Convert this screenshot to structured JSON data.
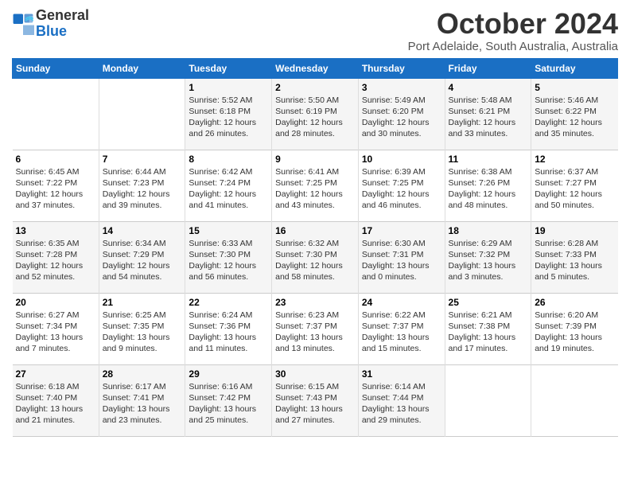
{
  "logo": {
    "general": "General",
    "blue": "Blue"
  },
  "title": "October 2024",
  "location": "Port Adelaide, South Australia, Australia",
  "days_of_week": [
    "Sunday",
    "Monday",
    "Tuesday",
    "Wednesday",
    "Thursday",
    "Friday",
    "Saturday"
  ],
  "weeks": [
    [
      {
        "day": "",
        "info": ""
      },
      {
        "day": "",
        "info": ""
      },
      {
        "day": "1",
        "info": "Sunrise: 5:52 AM\nSunset: 6:18 PM\nDaylight: 12 hours and 26 minutes."
      },
      {
        "day": "2",
        "info": "Sunrise: 5:50 AM\nSunset: 6:19 PM\nDaylight: 12 hours and 28 minutes."
      },
      {
        "day": "3",
        "info": "Sunrise: 5:49 AM\nSunset: 6:20 PM\nDaylight: 12 hours and 30 minutes."
      },
      {
        "day": "4",
        "info": "Sunrise: 5:48 AM\nSunset: 6:21 PM\nDaylight: 12 hours and 33 minutes."
      },
      {
        "day": "5",
        "info": "Sunrise: 5:46 AM\nSunset: 6:22 PM\nDaylight: 12 hours and 35 minutes."
      }
    ],
    [
      {
        "day": "6",
        "info": "Sunrise: 6:45 AM\nSunset: 7:22 PM\nDaylight: 12 hours and 37 minutes."
      },
      {
        "day": "7",
        "info": "Sunrise: 6:44 AM\nSunset: 7:23 PM\nDaylight: 12 hours and 39 minutes."
      },
      {
        "day": "8",
        "info": "Sunrise: 6:42 AM\nSunset: 7:24 PM\nDaylight: 12 hours and 41 minutes."
      },
      {
        "day": "9",
        "info": "Sunrise: 6:41 AM\nSunset: 7:25 PM\nDaylight: 12 hours and 43 minutes."
      },
      {
        "day": "10",
        "info": "Sunrise: 6:39 AM\nSunset: 7:25 PM\nDaylight: 12 hours and 46 minutes."
      },
      {
        "day": "11",
        "info": "Sunrise: 6:38 AM\nSunset: 7:26 PM\nDaylight: 12 hours and 48 minutes."
      },
      {
        "day": "12",
        "info": "Sunrise: 6:37 AM\nSunset: 7:27 PM\nDaylight: 12 hours and 50 minutes."
      }
    ],
    [
      {
        "day": "13",
        "info": "Sunrise: 6:35 AM\nSunset: 7:28 PM\nDaylight: 12 hours and 52 minutes."
      },
      {
        "day": "14",
        "info": "Sunrise: 6:34 AM\nSunset: 7:29 PM\nDaylight: 12 hours and 54 minutes."
      },
      {
        "day": "15",
        "info": "Sunrise: 6:33 AM\nSunset: 7:30 PM\nDaylight: 12 hours and 56 minutes."
      },
      {
        "day": "16",
        "info": "Sunrise: 6:32 AM\nSunset: 7:30 PM\nDaylight: 12 hours and 58 minutes."
      },
      {
        "day": "17",
        "info": "Sunrise: 6:30 AM\nSunset: 7:31 PM\nDaylight: 13 hours and 0 minutes."
      },
      {
        "day": "18",
        "info": "Sunrise: 6:29 AM\nSunset: 7:32 PM\nDaylight: 13 hours and 3 minutes."
      },
      {
        "day": "19",
        "info": "Sunrise: 6:28 AM\nSunset: 7:33 PM\nDaylight: 13 hours and 5 minutes."
      }
    ],
    [
      {
        "day": "20",
        "info": "Sunrise: 6:27 AM\nSunset: 7:34 PM\nDaylight: 13 hours and 7 minutes."
      },
      {
        "day": "21",
        "info": "Sunrise: 6:25 AM\nSunset: 7:35 PM\nDaylight: 13 hours and 9 minutes."
      },
      {
        "day": "22",
        "info": "Sunrise: 6:24 AM\nSunset: 7:36 PM\nDaylight: 13 hours and 11 minutes."
      },
      {
        "day": "23",
        "info": "Sunrise: 6:23 AM\nSunset: 7:37 PM\nDaylight: 13 hours and 13 minutes."
      },
      {
        "day": "24",
        "info": "Sunrise: 6:22 AM\nSunset: 7:37 PM\nDaylight: 13 hours and 15 minutes."
      },
      {
        "day": "25",
        "info": "Sunrise: 6:21 AM\nSunset: 7:38 PM\nDaylight: 13 hours and 17 minutes."
      },
      {
        "day": "26",
        "info": "Sunrise: 6:20 AM\nSunset: 7:39 PM\nDaylight: 13 hours and 19 minutes."
      }
    ],
    [
      {
        "day": "27",
        "info": "Sunrise: 6:18 AM\nSunset: 7:40 PM\nDaylight: 13 hours and 21 minutes."
      },
      {
        "day": "28",
        "info": "Sunrise: 6:17 AM\nSunset: 7:41 PM\nDaylight: 13 hours and 23 minutes."
      },
      {
        "day": "29",
        "info": "Sunrise: 6:16 AM\nSunset: 7:42 PM\nDaylight: 13 hours and 25 minutes."
      },
      {
        "day": "30",
        "info": "Sunrise: 6:15 AM\nSunset: 7:43 PM\nDaylight: 13 hours and 27 minutes."
      },
      {
        "day": "31",
        "info": "Sunrise: 6:14 AM\nSunset: 7:44 PM\nDaylight: 13 hours and 29 minutes."
      },
      {
        "day": "",
        "info": ""
      },
      {
        "day": "",
        "info": ""
      }
    ]
  ]
}
